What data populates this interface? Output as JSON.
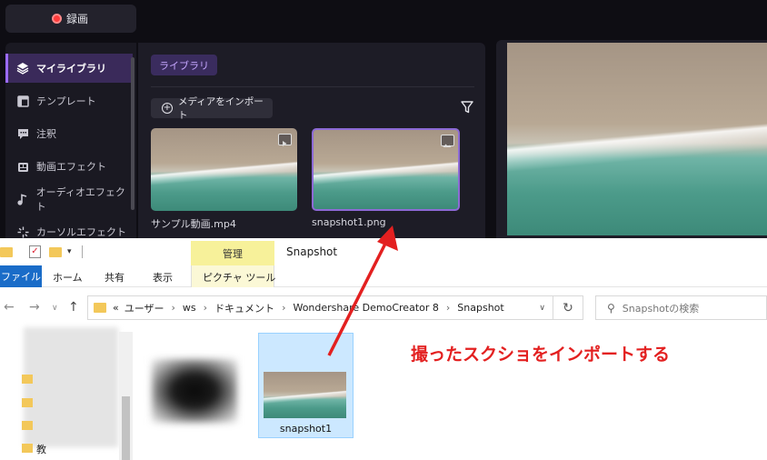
{
  "editor": {
    "record_label": "録画",
    "sidebar": {
      "items": [
        {
          "label": "マイライブラリ",
          "icon": "layers-icon",
          "active": true
        },
        {
          "label": "テンプレート",
          "icon": "template-icon",
          "active": false
        },
        {
          "label": "注釈",
          "icon": "annotation-icon",
          "active": false
        },
        {
          "label": "動画エフェクト",
          "icon": "video-effect-icon",
          "active": false
        },
        {
          "label": "オーディオエフェクト",
          "icon": "audio-effect-icon",
          "active": false
        },
        {
          "label": "カーソルエフェクト",
          "icon": "cursor-effect-icon",
          "active": false
        }
      ]
    },
    "library_tab": "ライブラリ",
    "import_label": "メディアをインポート",
    "media": [
      {
        "name": "サンプル動画.mp4",
        "type": "video"
      },
      {
        "name": "snapshot1.png",
        "type": "image"
      }
    ]
  },
  "explorer": {
    "manage_tab": "管理",
    "window_title": "Snapshot",
    "ribbon_tabs": {
      "file": "ファイル",
      "home": "ホーム",
      "share": "共有",
      "view": "表示",
      "picture_tools": "ピクチャ ツール"
    },
    "address": {
      "overflow": "«",
      "crumbs": [
        "ユーザー",
        "ws",
        "ドキュメント",
        "Wondershare DemoCreator 8",
        "Snapshot"
      ]
    },
    "search_placeholder": "Snapshotの検索",
    "file_name": "snapshot1",
    "nav_partial_text": "教"
  },
  "annotation": {
    "text": "撮ったスクショをインポートする",
    "color": "#e32020"
  },
  "colors": {
    "accent_purple": "#9b6bff",
    "record_red": "#ff3b3b",
    "file_tab_blue": "#1a6cc8",
    "manage_yellow": "#f7f19a",
    "selection_blue": "#cce8ff"
  }
}
